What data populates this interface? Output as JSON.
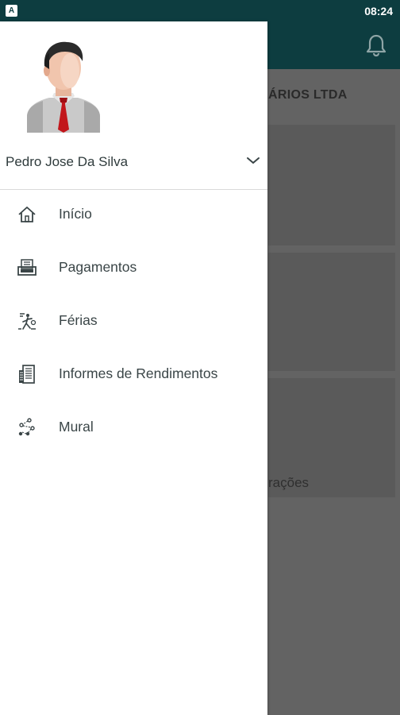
{
  "status_bar": {
    "notification_icon_letter": "A",
    "time": "08:24"
  },
  "background_app": {
    "company_name_fragment": "ÁRIOS LTDA",
    "card_text_fragment": "rações",
    "notification_icon": "bell-icon"
  },
  "drawer": {
    "profile": {
      "name": "Pedro Jose Da Silva",
      "avatar_icon": "user-avatar"
    },
    "menu": [
      {
        "label": "Início",
        "icon": "home-icon"
      },
      {
        "label": "Pagamentos",
        "icon": "payments-icon"
      },
      {
        "label": "Férias",
        "icon": "vacation-icon"
      },
      {
        "label": "Informes de Rendimentos",
        "icon": "income-report-icon"
      },
      {
        "label": "Mural",
        "icon": "mural-icon"
      }
    ]
  },
  "colors": {
    "appbar": "#0d3d40",
    "overlay": "#636363",
    "drawer_bg": "#ffffff",
    "text": "#3a4547"
  }
}
